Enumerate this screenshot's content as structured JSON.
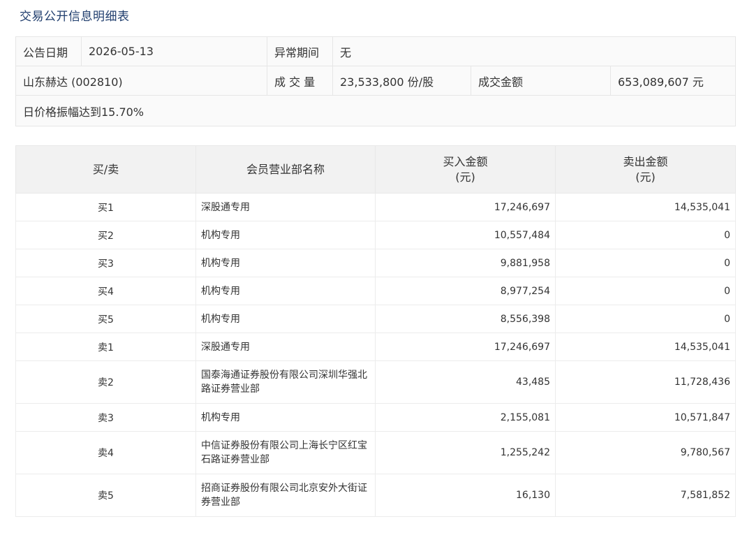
{
  "page": {
    "title": "交易公开信息明细表"
  },
  "info": {
    "announce_date_label": "公告日期",
    "announce_date_value": "2026-05-13",
    "abnormal_period_label": "异常期间",
    "abnormal_period_value": "无",
    "stock_name": "山东赫达 (002810)",
    "volume_label": "成 交 量",
    "volume_value": "23,533,800 份/股",
    "amount_label": "成交金额",
    "amount_value": "653,089,607 元",
    "reason": "日价格振幅达到15.70%"
  },
  "table": {
    "headers": {
      "side": "买/卖",
      "member": "会员营业部名称",
      "buy_amount": "买入金额",
      "buy_unit": "(元)",
      "sell_amount": "卖出金额",
      "sell_unit": "(元)"
    },
    "rows": [
      {
        "side": "买1",
        "member": "深股通专用",
        "buy": "17,246,697",
        "sell": "14,535,041"
      },
      {
        "side": "买2",
        "member": "机构专用",
        "buy": "10,557,484",
        "sell": "0"
      },
      {
        "side": "买3",
        "member": "机构专用",
        "buy": "9,881,958",
        "sell": "0"
      },
      {
        "side": "买4",
        "member": "机构专用",
        "buy": "8,977,254",
        "sell": "0"
      },
      {
        "side": "买5",
        "member": "机构专用",
        "buy": "8,556,398",
        "sell": "0"
      },
      {
        "side": "卖1",
        "member": "深股通专用",
        "buy": "17,246,697",
        "sell": "14,535,041"
      },
      {
        "side": "卖2",
        "member": "国泰海通证券股份有限公司深圳华强北路证券营业部",
        "buy": "43,485",
        "sell": "11,728,436"
      },
      {
        "side": "卖3",
        "member": "机构专用",
        "buy": "2,155,081",
        "sell": "10,571,847"
      },
      {
        "side": "卖4",
        "member": "中信证券股份有限公司上海长宁区红宝石路证券营业部",
        "buy": "1,255,242",
        "sell": "9,780,567"
      },
      {
        "side": "卖5",
        "member": "招商证券股份有限公司北京安外大街证券营业部",
        "buy": "16,130",
        "sell": "7,581,852"
      }
    ]
  }
}
